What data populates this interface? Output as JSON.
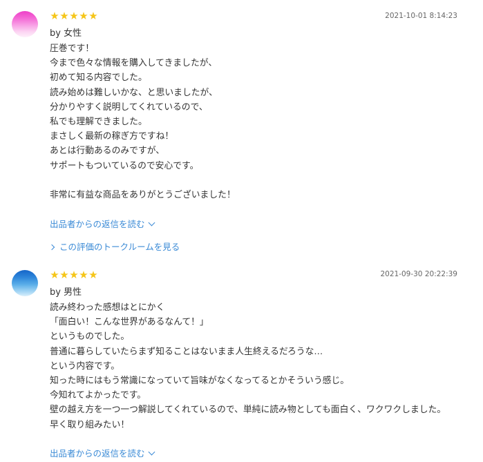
{
  "reviews": [
    {
      "rating": 5,
      "star_glyph": "★",
      "date": "2021-10-01 8:14:23",
      "author": "by 女性",
      "avatar_icon": "avatar-pink",
      "body": "圧巻です！\n今まで色々な情報を購入してきましたが、\n初めて知る内容でした。\n読み始めは難しいかな、と思いましたが、\n分かりやすく説明してくれているので、\n私でも理解できました。\nまさしく最新の稼ぎ方ですね！\nあとは行動あるのみですが、\nサポートもついているので安心です。\n\n非常に有益な商品をありがとうございました！",
      "reply_link": "出品者からの返信を読む",
      "talk_link": "この評価のトークルームを見る"
    },
    {
      "rating": 5,
      "star_glyph": "★",
      "date": "2021-09-30 20:22:39",
      "author": "by 男性",
      "avatar_icon": "avatar-blue",
      "body": "読み終わった感想はとにかく\n「面白い！こんな世界があるなんて！」\nというものでした。\n普通に暮らしていたらまず知ることはないまま人生終えるだろうな…\nという内容です。\n知った時にはもう常識になっていて旨味がなくなってるとかそういう感じ。\n今知れてよかったです。\n壁の越え方を一つ一つ解説してくれているので、単純に読み物としても面白く、ワクワクしました。\n早く取り組みたい！",
      "reply_link": "出品者からの返信を読む"
    }
  ],
  "colors": {
    "star": "#f5c518",
    "link": "#3a8ad6",
    "text": "#333333",
    "date": "#666666"
  }
}
